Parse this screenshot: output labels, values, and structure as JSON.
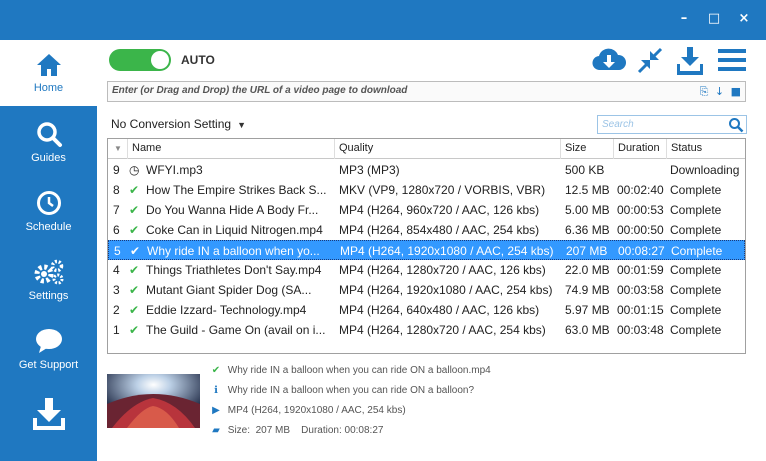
{
  "window": {
    "minimize": "–",
    "maximize": "□",
    "close": "×"
  },
  "sidebar": {
    "items": [
      {
        "label": "Home",
        "icon": "home-icon",
        "active": true
      },
      {
        "label": "Guides",
        "icon": "search-icon"
      },
      {
        "label": "Schedule",
        "icon": "clock-icon"
      },
      {
        "label": "Settings",
        "icon": "gears-icon"
      },
      {
        "label": "Get Support",
        "icon": "chat-bubble-icon"
      },
      {
        "label": "",
        "icon": "download-icon"
      }
    ]
  },
  "toolbar": {
    "auto_label": "AUTO",
    "toggle_state": "on",
    "icons": [
      "cloud-download-icon",
      "shrink-icon",
      "download-tray-icon",
      "hamburger-menu-icon"
    ]
  },
  "url_bar": {
    "placeholder": "Enter (or Drag and Drop) the URL of a video page to download",
    "icons": [
      "paste-icon",
      "arrow-down-icon",
      "video-camera-icon"
    ]
  },
  "conversion": {
    "label": "No Conversion Setting"
  },
  "search": {
    "placeholder": "Search"
  },
  "table": {
    "columns": [
      "Name",
      "Quality",
      "Size",
      "Duration",
      "Status"
    ],
    "rows": [
      {
        "num": "9",
        "icon": "clock",
        "name": "WFYI.mp3",
        "quality": "MP3  (MP3)",
        "size": "500 KB",
        "duration": "",
        "status": "Downloading",
        "selected": false
      },
      {
        "num": "8",
        "icon": "check",
        "name": "How The Empire Strikes Back S...",
        "quality": "MKV  (VP9, 1280x720 / VORBIS, VBR)",
        "size": "12.5 MB",
        "duration": "00:02:40",
        "status": "Complete",
        "selected": false
      },
      {
        "num": "7",
        "icon": "check",
        "name": "Do You Wanna Hide A Body Fr...",
        "quality": "MP4  (H264, 960x720 / AAC, 126 kbs)",
        "size": "5.00 MB",
        "duration": "00:00:53",
        "status": "Complete",
        "selected": false
      },
      {
        "num": "6",
        "icon": "check",
        "name": "Coke Can in Liquid Nitrogen.mp4",
        "quality": "MP4  (H264, 854x480 / AAC, 254 kbs)",
        "size": "6.36 MB",
        "duration": "00:00:50",
        "status": "Complete",
        "selected": false
      },
      {
        "num": "5",
        "icon": "check",
        "name": "Why ride IN a balloon when yo...",
        "quality": "MP4  (H264, 1920x1080 / AAC, 254 kbs)",
        "size": "207 MB",
        "duration": "00:08:27",
        "status": "Complete",
        "selected": true
      },
      {
        "num": "4",
        "icon": "check",
        "name": "Things Triathletes Don't Say.mp4",
        "quality": "MP4  (H264, 1280x720 / AAC, 126 kbs)",
        "size": "22.0 MB",
        "duration": "00:01:59",
        "status": "Complete",
        "selected": false
      },
      {
        "num": "3",
        "icon": "check",
        "name": "Mutant Giant Spider Dog (SA...",
        "quality": "MP4  (H264, 1920x1080 / AAC, 254 kbs)",
        "size": "74.9 MB",
        "duration": "00:03:58",
        "status": "Complete",
        "selected": false
      },
      {
        "num": "2",
        "icon": "check",
        "name": "Eddie Izzard- Technology.mp4",
        "quality": "MP4  (H264, 640x480 / AAC, 126 kbs)",
        "size": "5.97 MB",
        "duration": "00:01:15",
        "status": "Complete",
        "selected": false
      },
      {
        "num": "1",
        "icon": "check",
        "name": "The Guild - Game On (avail on i...",
        "quality": "MP4  (H264, 1280x720 / AAC, 254 kbs)",
        "size": "63.0 MB",
        "duration": "00:03:48",
        "status": "Complete",
        "selected": false
      }
    ]
  },
  "details": {
    "filename": "Why ride IN a balloon when you can ride ON a balloon.mp4",
    "title": "Why ride IN a balloon when you can ride ON a balloon?",
    "format": "MP4  (H264, 1920x1080 / AAC, 254 kbs)",
    "size_label": "Size:",
    "size": "207 MB",
    "duration_label": "Duration:",
    "duration": "00:08:27"
  },
  "colors": {
    "accent": "#1f78c1",
    "success": "#3bb54a",
    "selection": "#3399ff"
  }
}
